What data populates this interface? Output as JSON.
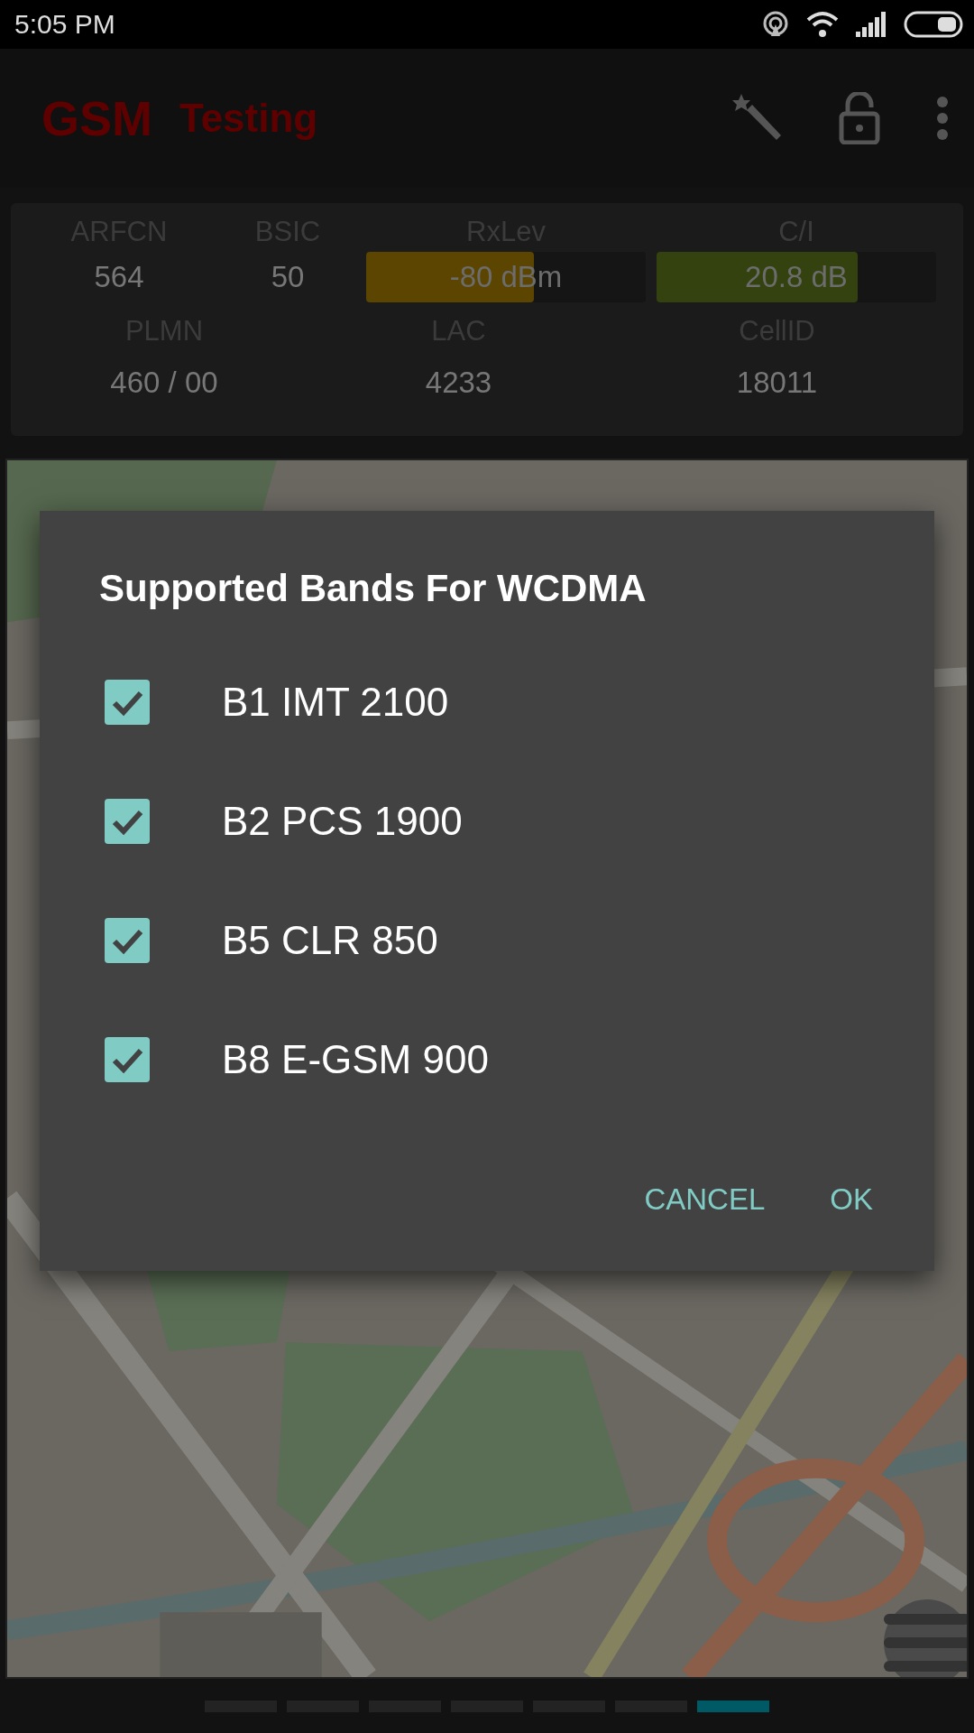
{
  "status_bar": {
    "time": "5:05 PM"
  },
  "app_bar": {
    "title": "GSM",
    "subtitle": "Testing"
  },
  "info_panel": {
    "top_fields": [
      {
        "kind": "text",
        "label": "ARFCN",
        "value": "564"
      },
      {
        "kind": "text",
        "label": "BSIC",
        "value": "50"
      },
      {
        "kind": "meter",
        "label": "RxLev",
        "value": "-80 dBm",
        "level": 0.6,
        "color": "#5c4500"
      },
      {
        "kind": "meter",
        "label": "C/I",
        "value": "20.8 dB",
        "level": 0.72,
        "color": "#33420f"
      }
    ],
    "bottom_fields": [
      {
        "label": "PLMN",
        "value": "460 / 00"
      },
      {
        "label": "LAC",
        "value": "4233"
      },
      {
        "label": "CellID",
        "value": "18011"
      }
    ]
  },
  "dialog": {
    "title": "Supported Bands For WCDMA",
    "options": [
      {
        "label": "B1 IMT 2100",
        "checked": true
      },
      {
        "label": "B2 PCS 1900",
        "checked": true
      },
      {
        "label": "B5 CLR 850",
        "checked": true
      },
      {
        "label": "B8 E-GSM 900",
        "checked": true
      }
    ],
    "buttons": [
      "CANCEL",
      "OK"
    ]
  },
  "pager": [
    {
      "selected": false
    },
    {
      "selected": false
    },
    {
      "selected": false
    },
    {
      "selected": false
    },
    {
      "selected": false
    },
    {
      "selected": false
    },
    {
      "selected": true
    }
  ]
}
